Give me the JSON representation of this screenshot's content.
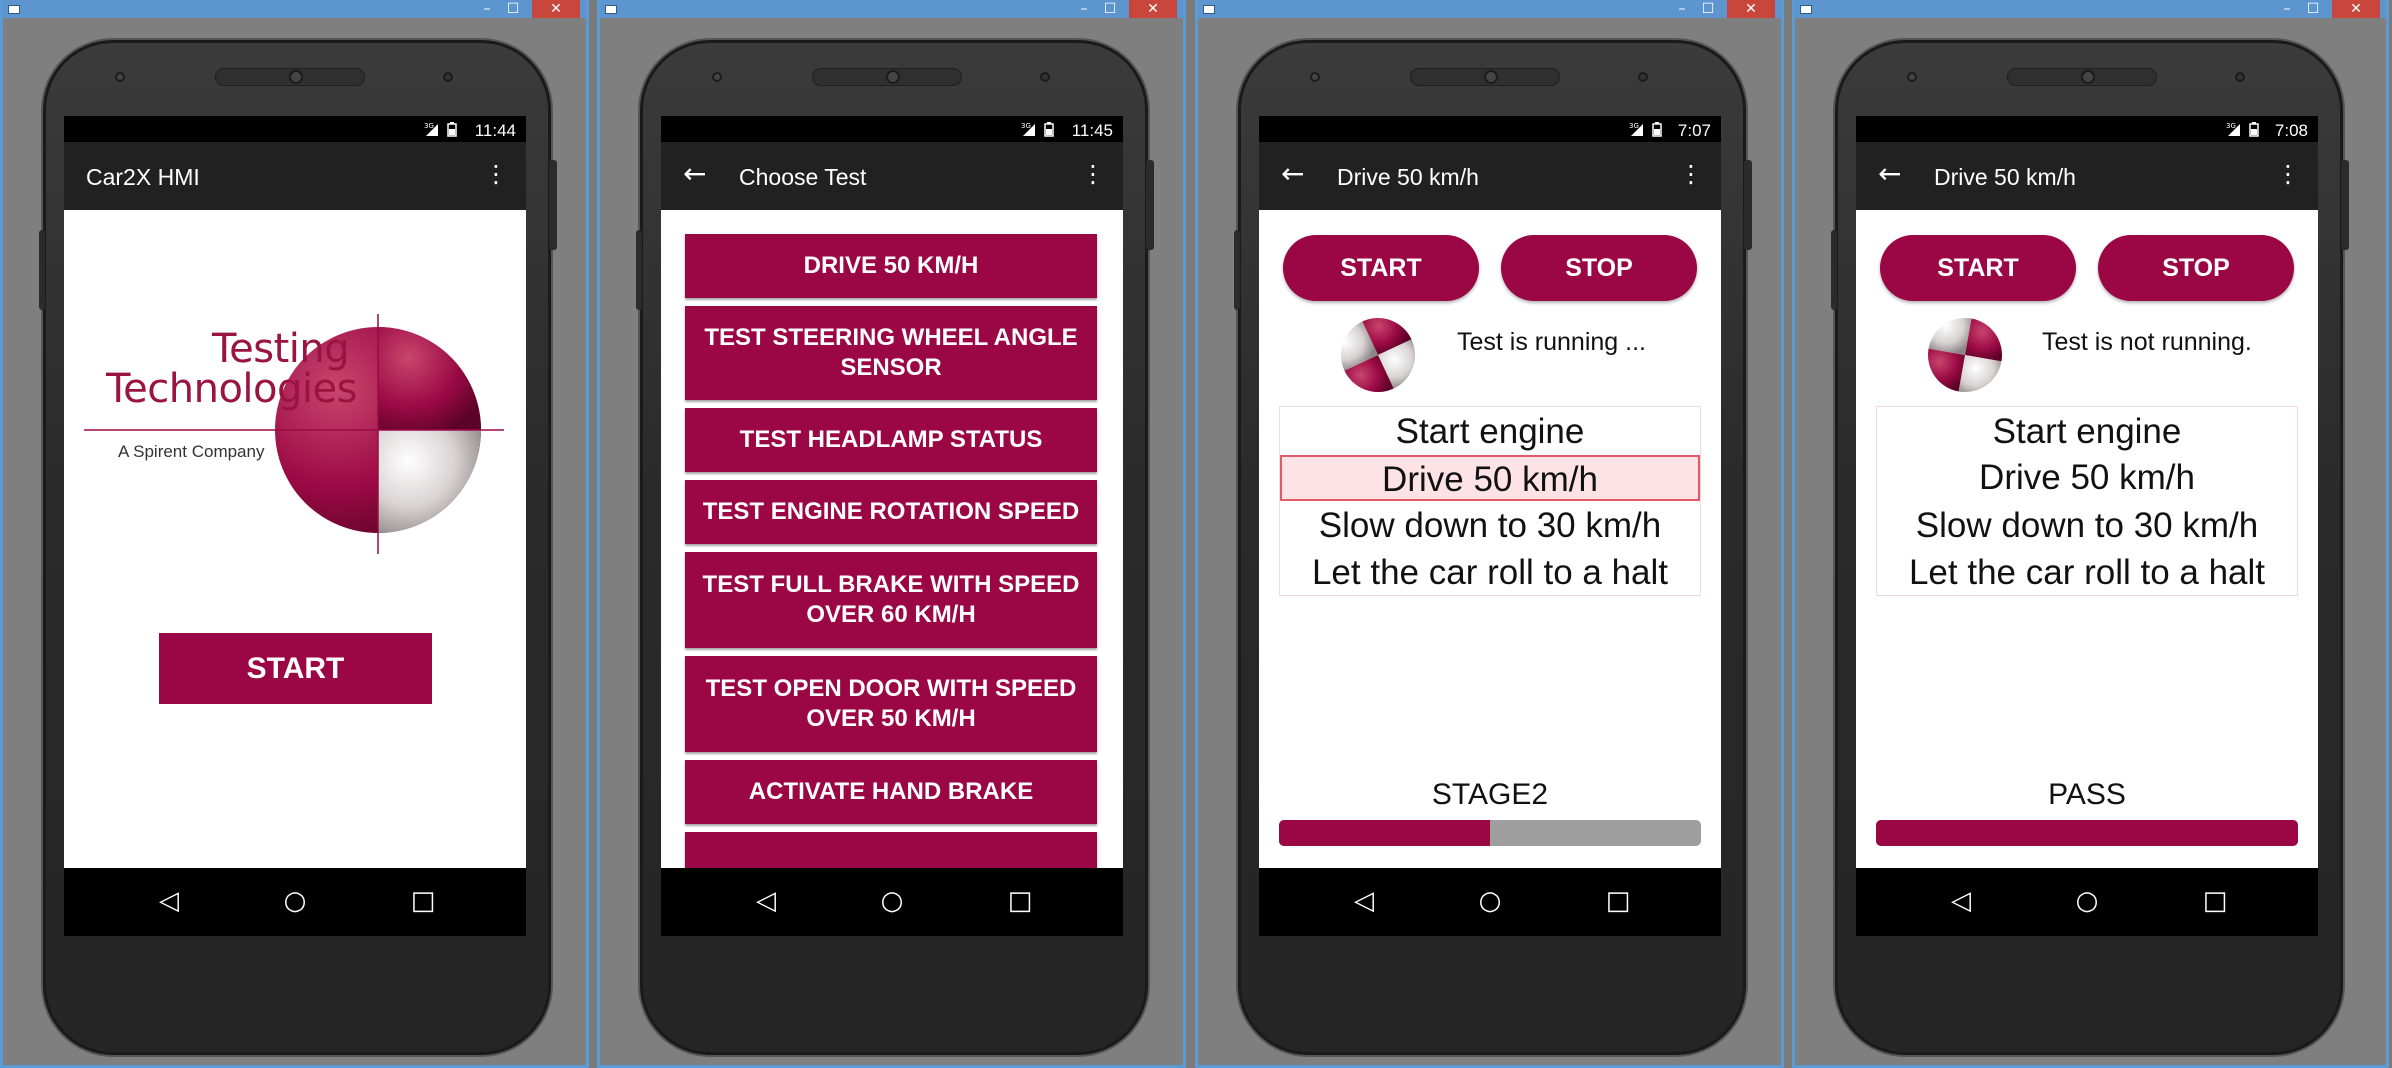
{
  "colors": {
    "accent": "#9b0644",
    "progress_track": "#9e9e9e",
    "highlight_bg": "#fde3e6",
    "highlight_border": "#e25a66"
  },
  "screens": [
    {
      "status_time": "11:44",
      "title": "Car2X HMI",
      "logo": {
        "line1": "Testing",
        "line2": "Technologies",
        "subtitle": "A Spirent Company"
      },
      "start_label": "START"
    },
    {
      "status_time": "11:45",
      "title": "Choose Test",
      "tests": [
        "DRIVE 50 KM/H",
        "TEST STEERING WHEEL ANGLE SENSOR",
        "TEST HEADLAMP STATUS",
        "TEST ENGINE ROTATION SPEED",
        "TEST FULL BRAKE WITH SPEED OVER 60 KM/H",
        "TEST OPEN DOOR WITH SPEED OVER 50 KM/H",
        "ACTIVATE HAND BRAKE"
      ]
    },
    {
      "status_time": "7:07",
      "title": "Drive 50 km/h",
      "start_label": "START",
      "stop_label": "STOP",
      "status_text": "Test is running ...",
      "steps": [
        "Start engine",
        "Drive 50 km/h",
        "Slow down to 30 km/h",
        "Let the car roll to a halt"
      ],
      "active_step": 1,
      "stage": "STAGE2",
      "progress": 0.5
    },
    {
      "status_time": "7:08",
      "title": "Drive 50 km/h",
      "start_label": "START",
      "stop_label": "STOP",
      "status_text": "Test is not running.",
      "steps": [
        "Start engine",
        "Drive 50 km/h",
        "Slow down to 30 km/h",
        "Let the car roll to a halt"
      ],
      "active_step": null,
      "stage": "PASS",
      "progress": 1.0
    }
  ],
  "icons": {
    "back": "arrow-left-icon",
    "overflow": "more-vert-icon",
    "nav_back": "nav-back-icon",
    "nav_home": "nav-home-icon",
    "nav_recents": "nav-recents-icon",
    "signal": "signal-3g-icon",
    "battery": "battery-icon"
  }
}
